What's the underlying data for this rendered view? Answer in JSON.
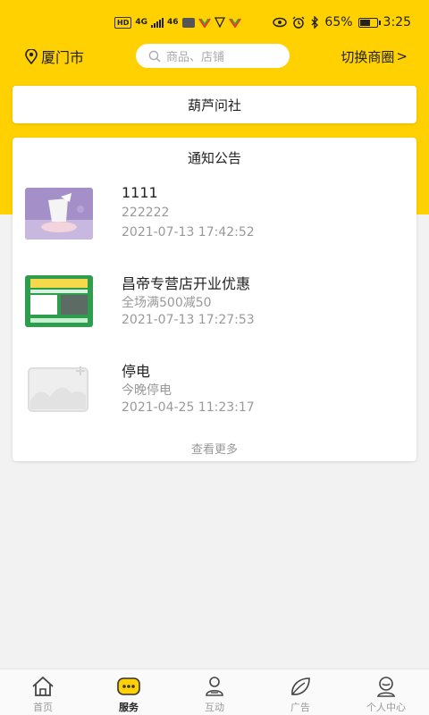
{
  "status_bar": {
    "left_badges": [
      "HD",
      "4G",
      "46"
    ],
    "battery_percent": "65%",
    "battery_level": 0.65,
    "time": "3:25"
  },
  "header": {
    "city": "厦门市",
    "search_placeholder": "商品、店铺",
    "switch_label": "切换商圈",
    "switch_arrow": ">"
  },
  "community": {
    "name": "葫芦问社"
  },
  "notices": {
    "title": "通知公告",
    "items": [
      {
        "title": "1111",
        "subtitle": "222222",
        "date": "2021-07-13 17:42:52",
        "thumb_icon": "product-photo"
      },
      {
        "title": "昌帝专营店开业优惠",
        "subtitle": "全场满500减50",
        "date": "2021-07-13 17:27:53",
        "thumb_icon": "promo-poster"
      },
      {
        "title": "停电",
        "subtitle": "今晚停电",
        "date": "2021-04-25 11:23:17",
        "thumb_icon": "image-placeholder"
      }
    ],
    "see_more": "查看更多"
  },
  "tab_bar": {
    "tabs": [
      {
        "label": "首页",
        "icon": "home-icon",
        "active": false
      },
      {
        "label": "服务",
        "icon": "service-icon",
        "active": true
      },
      {
        "label": "互动",
        "icon": "interact-icon",
        "active": false
      },
      {
        "label": "广告",
        "icon": "leaf-icon",
        "active": false
      },
      {
        "label": "个人中心",
        "icon": "profile-icon",
        "active": false
      }
    ]
  },
  "colors": {
    "brand_yellow": "#ffd100",
    "text_primary": "#222222",
    "text_secondary": "#999999"
  }
}
